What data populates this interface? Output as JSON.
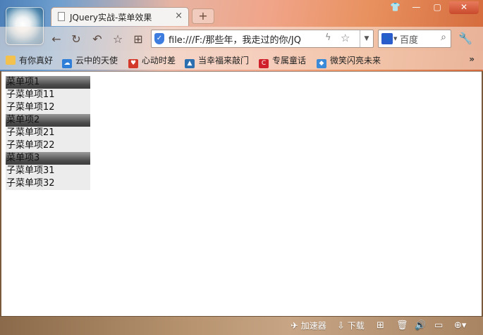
{
  "window": {
    "tab_title": "JQuery实战-菜单效果",
    "tab_close": "×",
    "new_tab": "+",
    "controls": {
      "shirt": "👕",
      "minimize": "—",
      "maximize": "▢",
      "close": "✕"
    }
  },
  "toolbar": {
    "back": "←",
    "refresh": "↻",
    "undo": "↶",
    "favorite": "☆",
    "apps": "⊞",
    "address": "file:///F:/那些年，我走过的你/JQ",
    "bolt": "ϟ",
    "star": "☆",
    "dropdown": "▼",
    "search_engine": "百度",
    "search_caret": "▼",
    "search_icon": "⌕",
    "wrench": "🔧"
  },
  "bookmarks": {
    "items": [
      {
        "label": "有你真好",
        "icon": "folder-icon",
        "color": "#f2c14e"
      },
      {
        "label": "云中的天使",
        "icon": "cloud-icon",
        "color": "#2f7fd8"
      },
      {
        "label": "心动时差",
        "icon": "heart-icon",
        "color": "#d43a2a"
      },
      {
        "label": "当幸福来敲门",
        "icon": "picture-icon",
        "color": "#2c6fb0"
      },
      {
        "label": "专属童话",
        "icon": "c-logo-icon",
        "color": "#d0202a"
      },
      {
        "label": "微笑闪亮未来",
        "icon": "diamond-icon",
        "color": "#3a8ad8"
      }
    ],
    "overflow": "»"
  },
  "menu": [
    {
      "header": "菜单项1",
      "items": [
        "子菜单项11",
        "子菜单项12"
      ]
    },
    {
      "header": "菜单项2",
      "items": [
        "子菜单项21",
        "子菜单项22"
      ]
    },
    {
      "header": "菜单项3",
      "items": [
        "子菜单项31",
        "子菜单项32"
      ]
    }
  ],
  "statusbar": {
    "accelerator": "加速器",
    "download": "下载",
    "glyphs": {
      "rocket": "✈",
      "download": "⇩",
      "add": "⊞",
      "trash": "🗑",
      "speaker": "🔊",
      "screen": "▭",
      "zoom": "⊕▾"
    }
  }
}
